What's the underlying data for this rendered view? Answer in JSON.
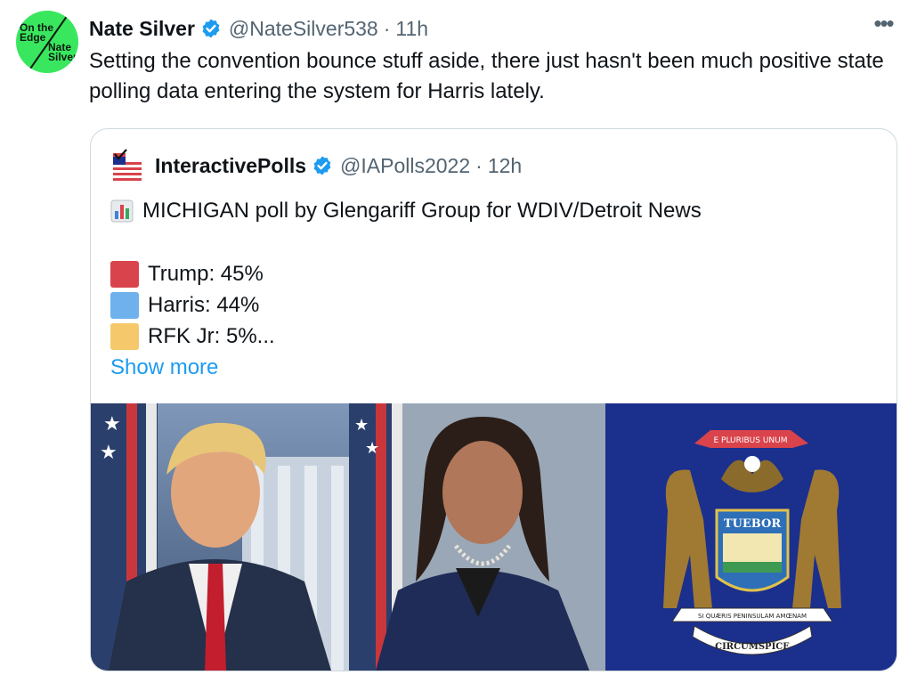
{
  "tweet": {
    "author_name": "Nate Silver",
    "handle": "@NateSilver538",
    "separator": "·",
    "time": "11h",
    "more_label": "•••",
    "text": "Setting the convention bounce stuff aside, there just hasn't been much positive state polling data entering the system for Harris lately.",
    "avatar": {
      "line1": "On the\nEdge",
      "line2": "Nate\nSilver"
    }
  },
  "quote": {
    "author_name": "InteractivePolls",
    "handle": "@IAPolls2022",
    "separator": "·",
    "time": "12h",
    "headline": "MICHIGAN poll by Glengariff Group for WDIV/Detroit News",
    "results": [
      {
        "label": "Trump: 45%",
        "color": "#d9434b"
      },
      {
        "label": "Harris: 44%",
        "color": "#6fb1ec"
      },
      {
        "label": "RFK Jr: 5%...",
        "color": "#f5c86b"
      }
    ],
    "show_more": "Show more",
    "seal": {
      "banner_top": "E PLURIBUS UNUM",
      "shield": "TUEBOR",
      "banner_bottom": "SI QUÆRIS PENINSULAM AMŒNAM",
      "motto": "CIRCUMSPICE"
    }
  },
  "colors": {
    "link_blue": "#1d9bf0",
    "verified_blue": "#1d9bf0",
    "avatar_green": "#39e75f",
    "flag_blue": "#1b2f8d"
  }
}
